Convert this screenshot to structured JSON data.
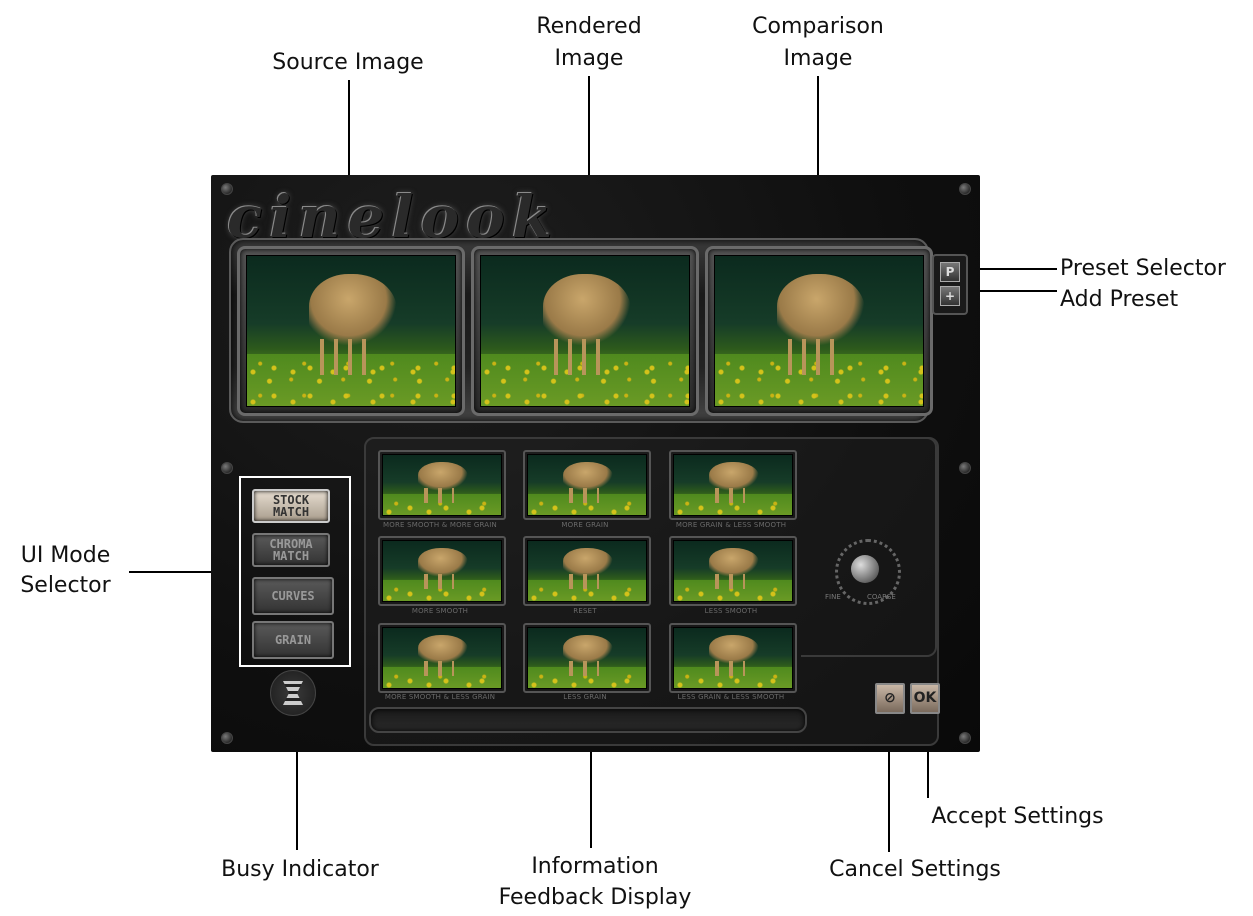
{
  "app": {
    "logo_text": "cinelook"
  },
  "preview": {
    "frames": [
      {
        "name": "source"
      },
      {
        "name": "rendered"
      },
      {
        "name": "comparison"
      }
    ],
    "preset_selector_label": "P",
    "add_preset_label": "+"
  },
  "modes": [
    {
      "label": "STOCK MATCH",
      "active": true
    },
    {
      "label": "CHROMA MATCH",
      "active": false
    },
    {
      "label": "CURVES",
      "active": false
    },
    {
      "label": "GRAIN",
      "active": false
    }
  ],
  "variations": [
    "MORE SMOOTH & MORE GRAIN",
    "MORE GRAIN",
    "MORE GRAIN & LESS SMOOTH",
    "MORE SMOOTH",
    "RESET",
    "LESS SMOOTH",
    "MORE SMOOTH & LESS GRAIN",
    "LESS GRAIN",
    "LESS GRAIN & LESS SMOOTH"
  ],
  "knob": {
    "fine_label": "FINE",
    "coarse_label": "COARSE"
  },
  "buttons": {
    "cancel_symbol": "⊘",
    "ok_label": "OK"
  },
  "callouts": {
    "source_image": "Source Image",
    "rendered_image_l1": "Rendered",
    "rendered_image_l2": "Image",
    "comparison_image_l1": "Comparison",
    "comparison_image_l2": "Image",
    "preset_selector": "Preset Selector",
    "add_preset": "Add Preset",
    "ui_mode_l1": "UI Mode",
    "ui_mode_l2": "Selector",
    "busy_indicator": "Busy Indicator",
    "info_feedback_l1": "Information",
    "info_feedback_l2": "Feedback Display",
    "cancel_settings": "Cancel Settings",
    "accept_settings": "Accept Settings"
  }
}
